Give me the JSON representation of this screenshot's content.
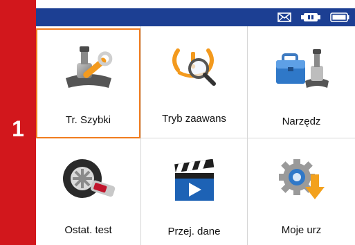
{
  "sidebar": {
    "step_number": "1",
    "color": "#d2171c"
  },
  "status_bar": {
    "color": "#1c3f93",
    "icons": [
      "mail-icon",
      "connection-icon",
      "battery-icon"
    ]
  },
  "menu": {
    "selected_color": "#f07c1f",
    "tiles": [
      {
        "label": "Tr. Szybki",
        "icon": "tpms-sensor-wrench-icon",
        "selected": true
      },
      {
        "label": "Tryb zaawans",
        "icon": "tpms-warning-magnifier-icon",
        "selected": false
      },
      {
        "label": "Narzędz",
        "icon": "toolbox-sensor-icon",
        "selected": false
      },
      {
        "label": "Ostat. test",
        "icon": "tire-sensor-icon",
        "selected": false
      },
      {
        "label": "Przej. dane",
        "icon": "video-clapper-icon",
        "selected": false
      },
      {
        "label": "Moje urz",
        "icon": "gear-download-icon",
        "selected": false
      }
    ]
  }
}
